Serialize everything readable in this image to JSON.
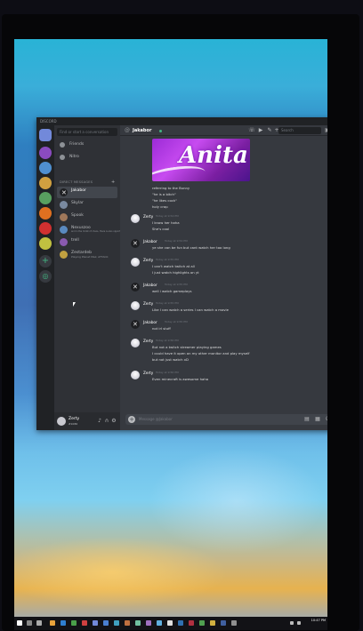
{
  "app": {
    "title": "DISCORD"
  },
  "sidebar": {
    "search_placeholder": "Find or start a conversation",
    "nav": [
      {
        "label": "Friends",
        "icon": "friends-icon"
      },
      {
        "label": "Nitro",
        "icon": "nitro-icon"
      }
    ],
    "dm_header": "DIRECT MESSAGES",
    "dms": [
      {
        "name": "Jakabor",
        "status": "",
        "color": "#1e1f22",
        "active": true
      },
      {
        "name": "Skylar",
        "status": "",
        "color": "#7a8aa0",
        "active": false
      },
      {
        "name": "Spook",
        "status": "",
        "color": "#a0785a",
        "active": false
      },
      {
        "name": "Nexuszoo",
        "status": "and in the midst of chaos, there is also opportunity",
        "color": "#5a8ac0",
        "active": false
      },
      {
        "name": "trell",
        "status": "",
        "color": "#8a5ab0",
        "active": false
      },
      {
        "name": "Zestardeb",
        "status": "Playing Planet Maz; ATTACK",
        "color": "#c0a040",
        "active": false
      }
    ],
    "user": {
      "name": "Zerty",
      "tag": "#1086"
    }
  },
  "chat": {
    "recipient": "Jakabor",
    "search_placeholder": "Search",
    "banner_text": "Anita",
    "composer_placeholder": "Message @Jakabor",
    "messages": [
      {
        "type": "cont",
        "text": "referring to the Bunny"
      },
      {
        "type": "cont",
        "text": "\"he is a bitch\""
      },
      {
        "type": "cont",
        "text": "\"he likes cock\""
      },
      {
        "type": "cont",
        "text": "holy crap"
      },
      {
        "type": "head",
        "author": "Zerty",
        "time": "Today at 9:54 PM",
        "avatar": "zerty",
        "lines": [
          "I know her haha",
          "She's cool"
        ]
      },
      {
        "type": "head",
        "author": "Jakabor",
        "time": "Today at 9:54 PM",
        "avatar": "jaka",
        "lines": [
          "ye she can be fun but cant watch her too long"
        ]
      },
      {
        "type": "head",
        "author": "Zerty",
        "time": "Today at 9:55 PM",
        "avatar": "zerty",
        "lines": [
          "I can't watch twitch at all",
          "I just watch highlights on yt"
        ]
      },
      {
        "type": "head",
        "author": "Jakabor",
        "time": "Today at 9:55 PM",
        "avatar": "jaka",
        "lines": [
          "well i watch gameplays"
        ]
      },
      {
        "type": "head",
        "author": "Zerty",
        "time": "Today at 9:55 PM",
        "avatar": "zerty",
        "lines": [
          "Like I can watch a series I can watch a movie"
        ]
      },
      {
        "type": "head",
        "author": "Jakabor",
        "time": "Today at 9:55 PM",
        "avatar": "jaka",
        "lines": [
          "not irl stuff"
        ]
      },
      {
        "type": "head",
        "author": "Zerty",
        "time": "Today at 9:56 PM",
        "avatar": "zerty",
        "lines": [
          "But not a twitch streamer playing games",
          "I could have it open on my other monitor and play myself",
          "but not just watch xD"
        ]
      },
      {
        "type": "head",
        "author": "Zerty",
        "time": "Today at 9:56 PM",
        "avatar": "zerty",
        "lines": [
          "Even minecraft is awesome haha"
        ]
      }
    ]
  },
  "taskbar": {
    "time": "10:47 PM"
  },
  "colors": {
    "accent": "#7289da",
    "online": "#43b581",
    "bg": "#36393f"
  }
}
